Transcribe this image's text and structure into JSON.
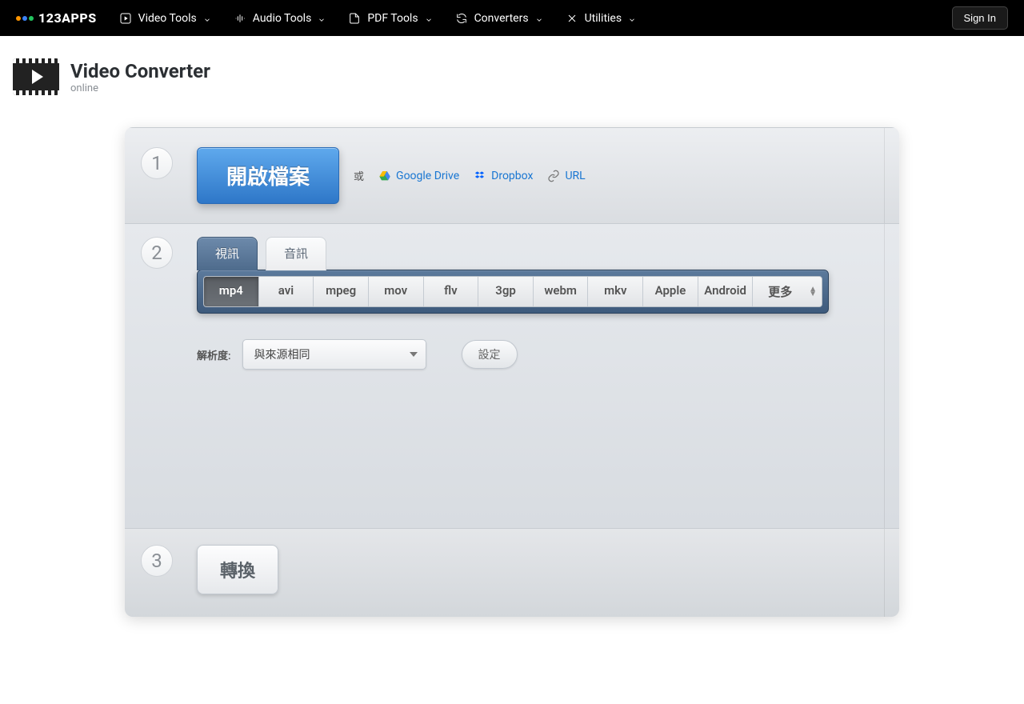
{
  "nav": {
    "brand": "123APPS",
    "items": [
      {
        "label": "Video Tools"
      },
      {
        "label": "Audio Tools"
      },
      {
        "label": "PDF Tools"
      },
      {
        "label": "Converters"
      },
      {
        "label": "Utilities"
      }
    ],
    "signin": "Sign In"
  },
  "page": {
    "title": "Video Converter",
    "subtitle": "online"
  },
  "step1": {
    "num": "1",
    "open_button": "開啟檔案",
    "or": "或",
    "google_drive": "Google Drive",
    "dropbox": "Dropbox",
    "url": "URL"
  },
  "step2": {
    "num": "2",
    "tabs": {
      "video": "視訊",
      "audio": "音訊"
    },
    "formats": [
      "mp4",
      "avi",
      "mpeg",
      "mov",
      "flv",
      "3gp",
      "webm",
      "mkv",
      "Apple",
      "Android",
      "更多"
    ],
    "active_format": "mp4",
    "resolution_label": "解析度:",
    "resolution_value": "與來源相同",
    "settings_button": "設定"
  },
  "step3": {
    "num": "3",
    "convert_button": "轉換"
  }
}
